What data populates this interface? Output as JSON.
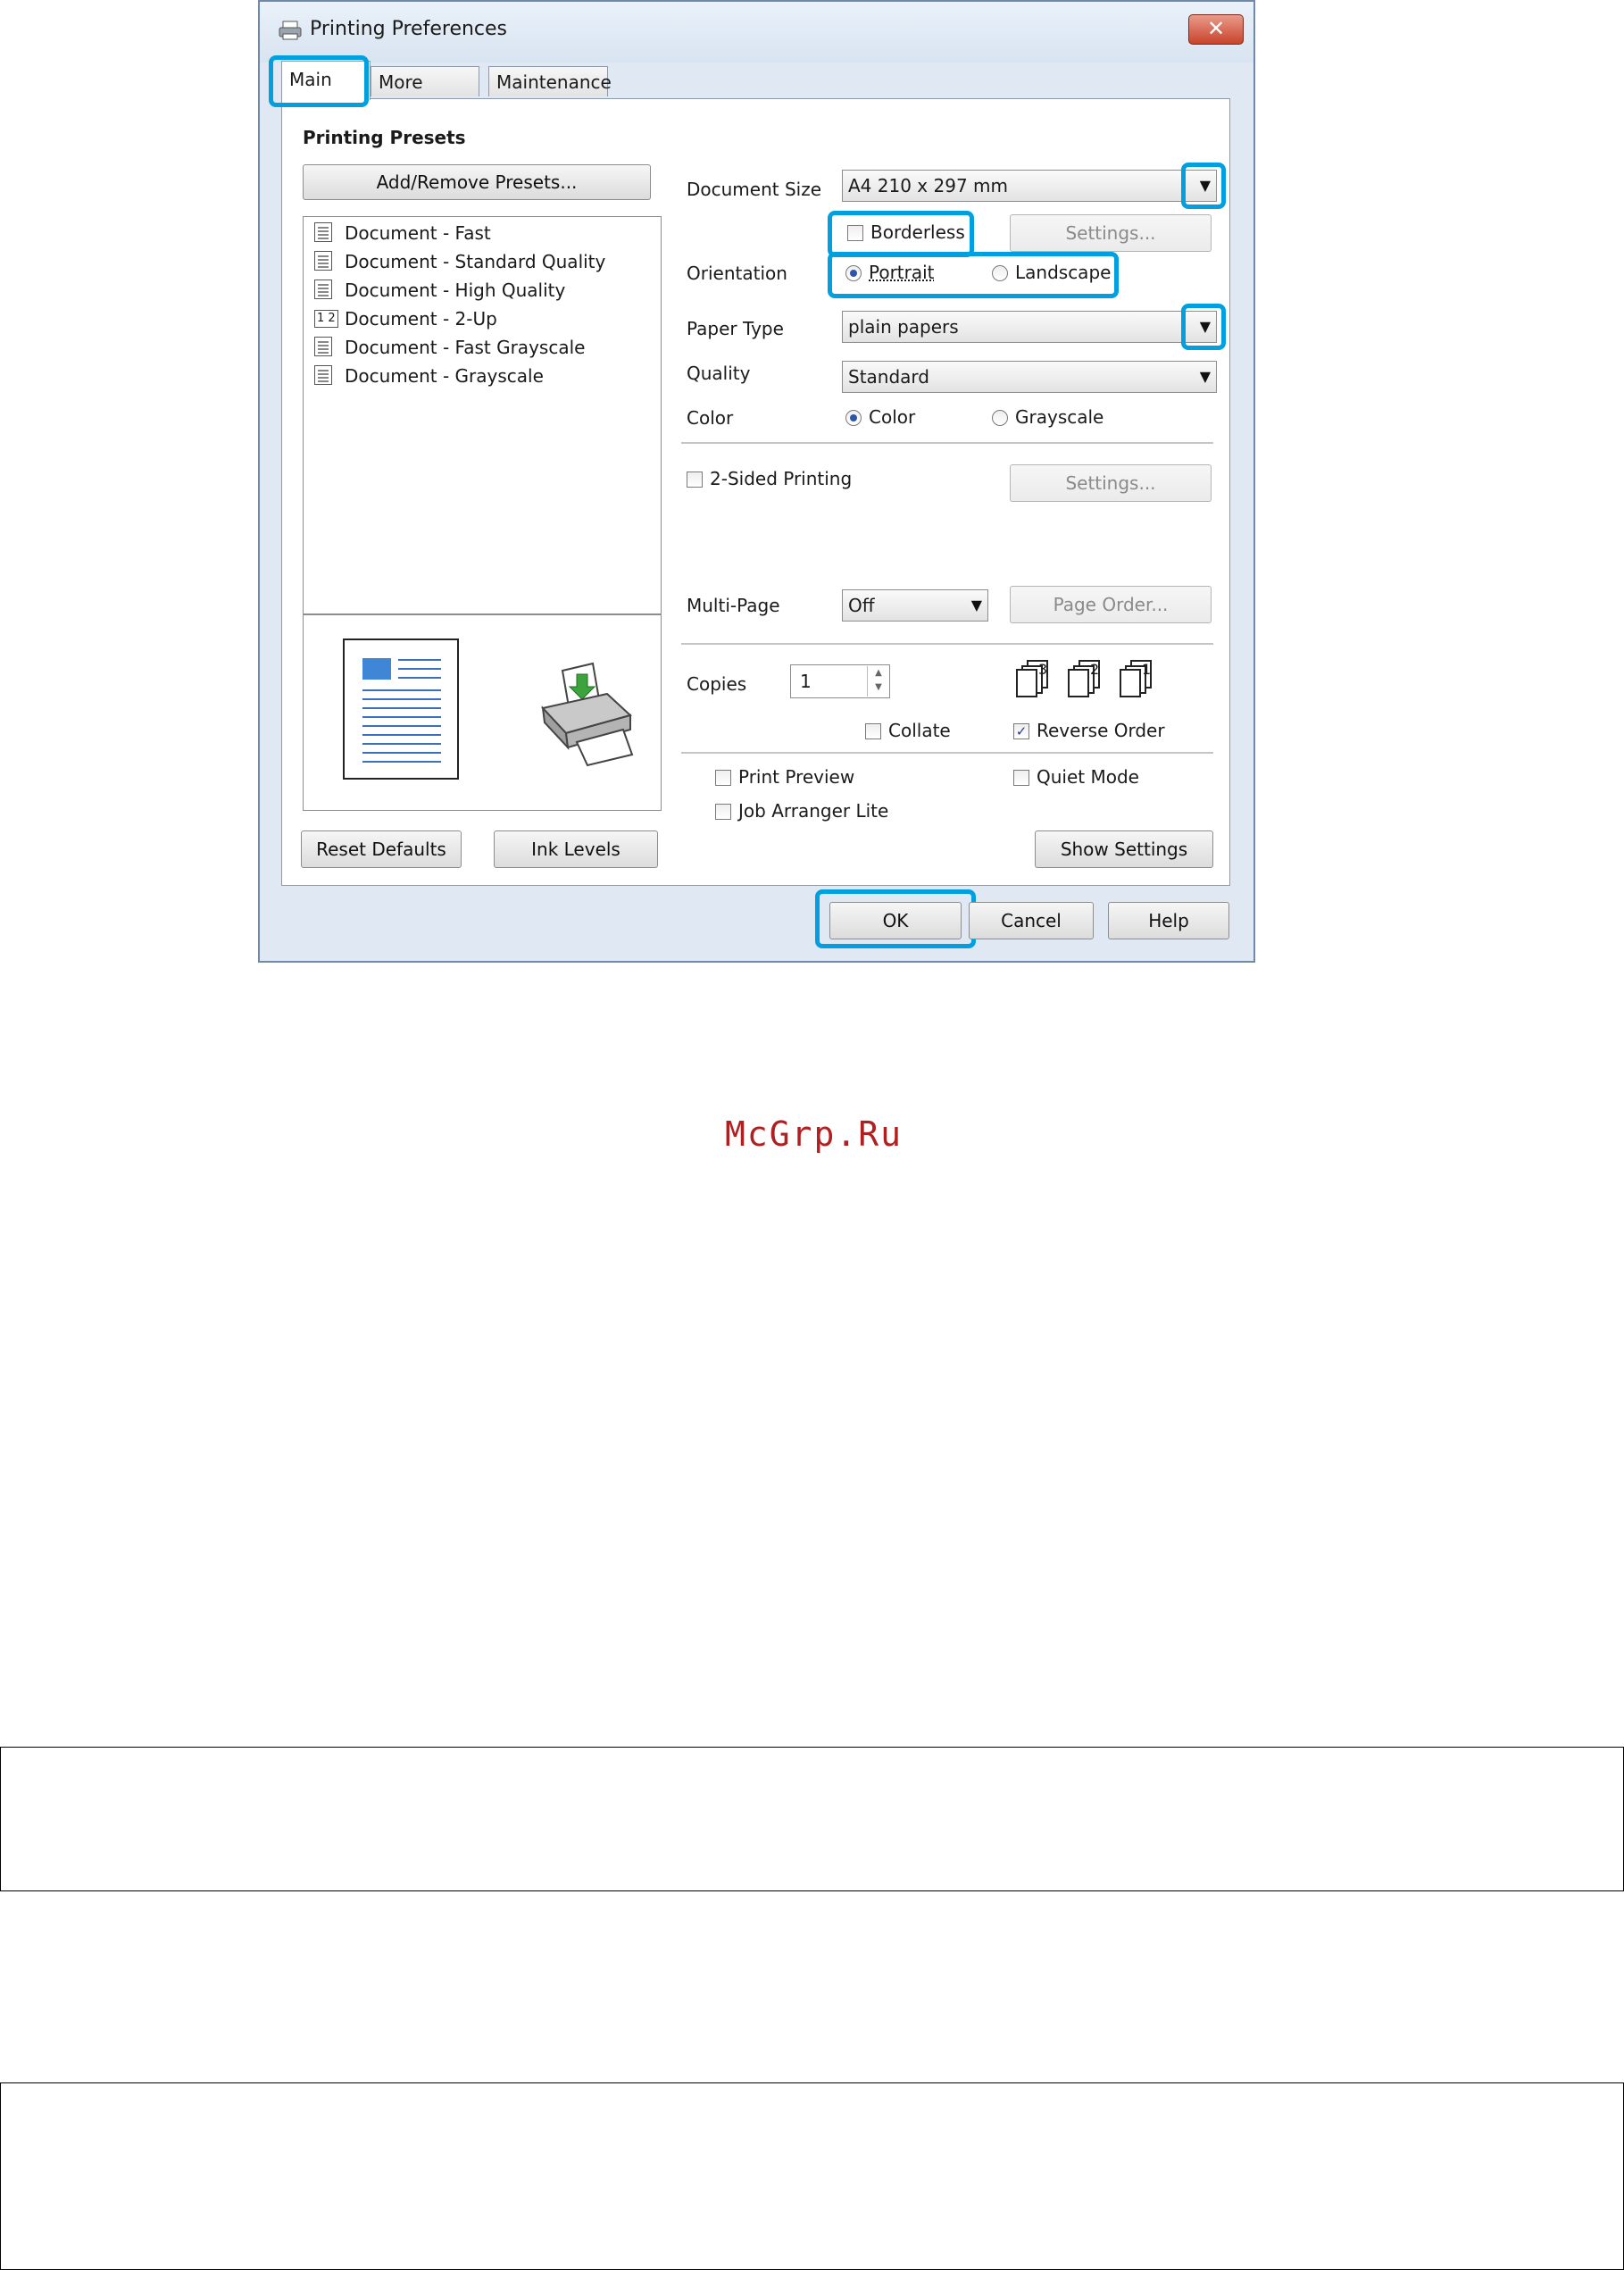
{
  "window": {
    "title": "Printing Preferences",
    "close_glyph": "✕",
    "icon": "printer-icon"
  },
  "tabs": [
    {
      "label": "Main"
    },
    {
      "label": "More Options"
    },
    {
      "label": "Maintenance"
    }
  ],
  "presets": {
    "heading": "Printing Presets",
    "add_remove_label": "Add/Remove Presets...",
    "items": [
      {
        "label": "Document - Fast"
      },
      {
        "label": "Document - Standard Quality"
      },
      {
        "label": "Document - High Quality"
      },
      {
        "label": "Document - 2-Up"
      },
      {
        "label": "Document - Fast Grayscale"
      },
      {
        "label": "Document - Grayscale"
      }
    ],
    "twoup_icon_text": "1 2"
  },
  "settings": {
    "document_size": {
      "label": "Document Size",
      "value": "A4 210 x 297 mm"
    },
    "borderless": {
      "label": "Borderless",
      "checked": false
    },
    "borderless_settings_label": "Settings...",
    "orientation": {
      "label": "Orientation",
      "portrait": "Portrait",
      "landscape": "Landscape",
      "selected": "Portrait"
    },
    "paper_type": {
      "label": "Paper Type",
      "value": "plain papers"
    },
    "quality": {
      "label": "Quality",
      "value": "Standard"
    },
    "color": {
      "label": "Color",
      "color": "Color",
      "grayscale": "Grayscale",
      "selected": "Color"
    },
    "two_sided": {
      "label": "2-Sided Printing",
      "checked": false
    },
    "two_sided_settings_label": "Settings...",
    "multi_page": {
      "label": "Multi-Page",
      "value": "Off"
    },
    "page_order_label": "Page Order...",
    "copies": {
      "label": "Copies",
      "value": "1"
    },
    "collate": {
      "label": "Collate",
      "checked": false
    },
    "reverse_order": {
      "label": "Reverse Order",
      "checked": true
    },
    "order_icons": [
      "3",
      "2",
      "1"
    ],
    "print_preview": {
      "label": "Print Preview",
      "checked": false
    },
    "quiet_mode": {
      "label": "Quiet Mode",
      "checked": false
    },
    "job_arranger": {
      "label": "Job Arranger Lite",
      "checked": false
    },
    "show_settings_label": "Show Settings"
  },
  "bottom_buttons": {
    "reset_defaults": "Reset Defaults",
    "ink_levels": "Ink Levels",
    "ok": "OK",
    "cancel": "Cancel",
    "help": "Help"
  },
  "watermark": "McGrp.Ru",
  "colors": {
    "highlight": "#00a0e0",
    "watermark": "#b02020",
    "accent": "#2a55a8"
  }
}
